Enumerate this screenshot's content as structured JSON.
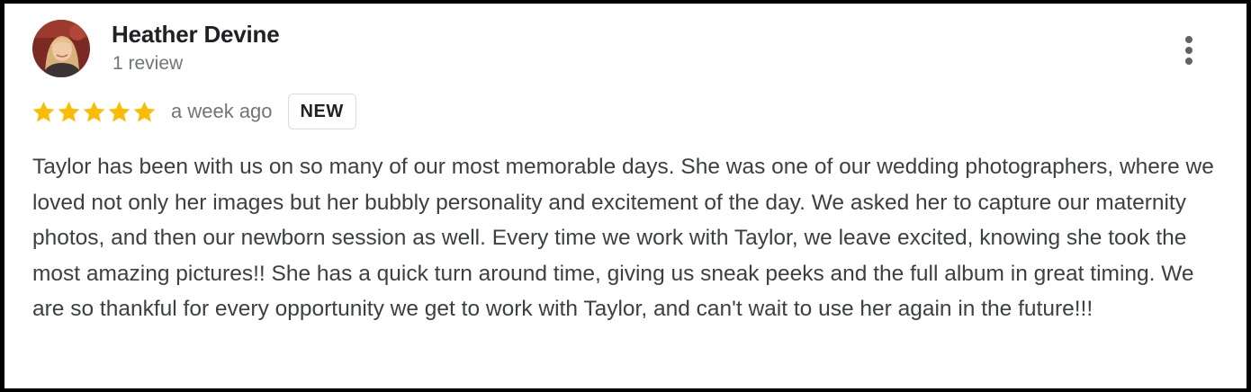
{
  "reviewer": {
    "name": "Heather Devine",
    "review_count": "1 review"
  },
  "review": {
    "rating": 5,
    "max_rating": 5,
    "date": "a week ago",
    "badge": "NEW",
    "text": "Taylor has been with us on so many of our most memorable days. She was one of our wedding photographers, where we loved not only her images but her bubbly personality and excitement of the day. We asked her to capture our maternity photos, and then our newborn session as well. Every time we work with Taylor, we leave excited, knowing she took the most amazing pictures!! She has a quick turn around time, giving us sneak peeks and the full album in great timing. We are so thankful for every opportunity we get to work with Taylor, and can't wait to use her again in the future!!!"
  },
  "icons": {
    "star": "star-icon",
    "more": "more-vert-icon"
  },
  "colors": {
    "star": "#fbbc04",
    "name": "#202124",
    "secondary_text": "#70757a",
    "body_text": "#3c4043"
  }
}
